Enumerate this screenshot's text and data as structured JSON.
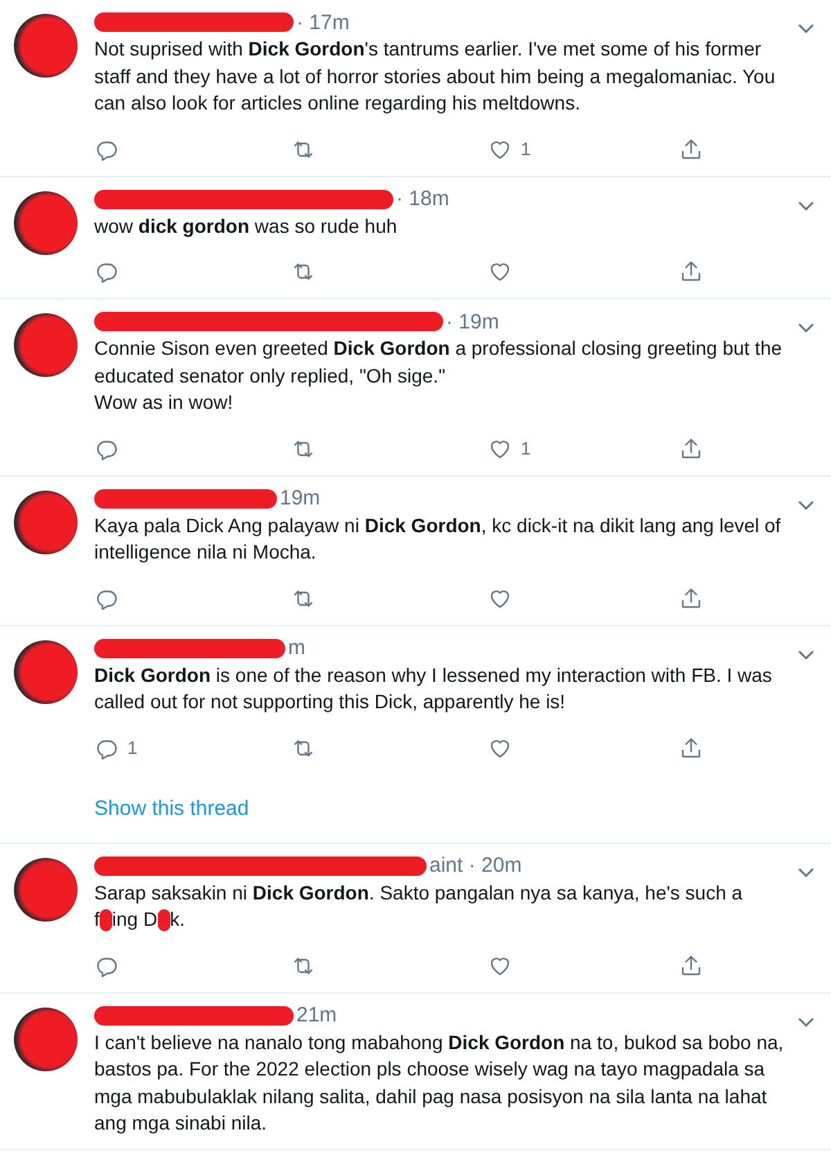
{
  "tweets": [
    {
      "time": "· 17m",
      "body": "Not suprised with **Dick Gordon**'s tantrums earlier. I've met some of his former staff and they have a lot of horror stories about him being a megalomaniac. You can also look for articles online regarding his meltdowns.",
      "actions": [
        {
          "kind": "reply"
        },
        {
          "kind": "retweet"
        },
        {
          "kind": "like",
          "count": "1"
        },
        {
          "kind": "share"
        }
      ]
    },
    {
      "time": "· 18m",
      "body": "wow **dick gordon** was so rude huh",
      "actions": [
        {
          "kind": "reply"
        },
        {
          "kind": "retweet"
        },
        {
          "kind": "like"
        },
        {
          "kind": "share"
        }
      ]
    },
    {
      "time": "· 19m",
      "body": "Connie Sison even greeted **Dick Gordon** a professional closing greeting but the educated senator only replied, \"Oh sige.\"\nWow as in wow!",
      "actions": [
        {
          "kind": "reply"
        },
        {
          "kind": "retweet"
        },
        {
          "kind": "like",
          "count": "1"
        },
        {
          "kind": "share"
        }
      ]
    },
    {
      "time": "19m",
      "body": "Kaya pala Dick Ang palayaw ni **Dick Gordon**, kc dick-it na dikit lang ang level of intelligence nila ni Mocha.",
      "actions": [
        {
          "kind": "reply"
        },
        {
          "kind": "retweet"
        },
        {
          "kind": "like"
        },
        {
          "kind": "share"
        }
      ]
    },
    {
      "time": "m",
      "body": "**Dick Gordon** is one of the reason why I lessened my interaction with FB. I was called out for not supporting this Dick, apparently he is!",
      "actions": [
        {
          "kind": "reply",
          "count": "1"
        },
        {
          "kind": "retweet"
        },
        {
          "kind": "like"
        },
        {
          "kind": "share"
        }
      ],
      "thread_link": "Show this thread"
    },
    {
      "time": "aint · 20m",
      "body_parts": [
        {
          "kind": "text",
          "text": "Sarap saksakin ni **Dick Gordon**. Sakto pangalan nya sa kanya, he's such a"
        },
        {
          "kind": "text",
          "text": "f"
        },
        {
          "kind": "redaction"
        },
        {
          "kind": "text",
          "text": "ing D"
        },
        {
          "kind": "redaction"
        },
        {
          "kind": "text",
          "text": "k."
        }
      ],
      "actions": [
        {
          "kind": "reply"
        },
        {
          "kind": "retweet"
        },
        {
          "kind": "like"
        },
        {
          "kind": "share"
        }
      ]
    },
    {
      "time": "21m",
      "body": "I can't believe na nanalo tong mabahong **Dick Gordon** na to, bukod sa bobo na, bastos pa. For the 2022 election pls choose wisely wag na tayo magpadala sa mga mabubulaklak nilang salita, dahil pag nasa posisyon na sila lanta na lahat ang mga sinabi nila."
    }
  ]
}
